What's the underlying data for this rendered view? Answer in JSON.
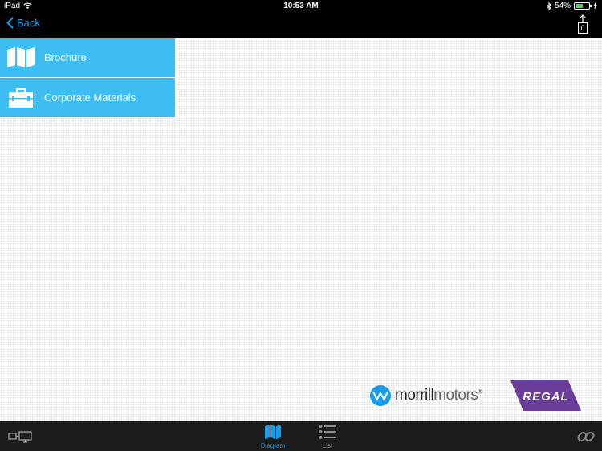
{
  "status": {
    "device": "iPad",
    "time": "10:53 AM",
    "battery": "54%",
    "battery_level": 0.54
  },
  "nav": {
    "back_label": "Back",
    "share_count": "0"
  },
  "menu": {
    "items": [
      {
        "label": "Brochure",
        "icon": "map-icon"
      },
      {
        "label": "Corporate Materials",
        "icon": "briefcase-icon"
      }
    ]
  },
  "logos": {
    "morrill": {
      "part1": "morrill",
      "part2": "motors",
      "mark": "®"
    },
    "regal": "REGAL"
  },
  "tabs": [
    {
      "label": "Diagram",
      "icon": "map-icon",
      "active": true
    },
    {
      "label": "List",
      "icon": "list-icon",
      "active": false
    }
  ],
  "colors": {
    "accent": "#1a9be6",
    "menu_bg": "#3dbdf1",
    "regal_purple": "#6b3d9a",
    "battery_green": "#4cd964"
  }
}
